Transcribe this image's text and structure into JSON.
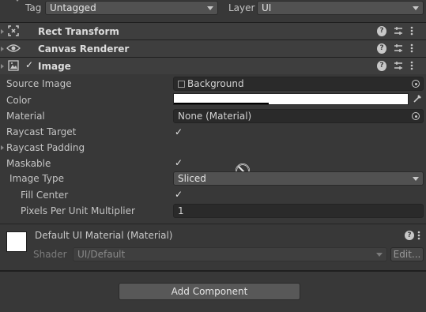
{
  "top": {
    "tag_label": "Tag",
    "tag_value": "Untagged",
    "layer_label": "Layer",
    "layer_value": "UI"
  },
  "components": {
    "rect_transform": "Rect Transform",
    "canvas_renderer": "Canvas Renderer",
    "image": "Image"
  },
  "image_props": {
    "source_image_label": "Source Image",
    "source_image_value": "Background",
    "color_label": "Color",
    "color_value": "#ffffff",
    "material_label": "Material",
    "material_value": "None (Material)",
    "raycast_target_label": "Raycast Target",
    "raycast_target_checked": true,
    "raycast_padding_label": "Raycast Padding",
    "maskable_label": "Maskable",
    "maskable_checked": true,
    "image_type_label": "Image Type",
    "image_type_value": "Sliced",
    "fill_center_label": "Fill Center",
    "fill_center_checked": true,
    "ppu_label": "Pixels Per Unit Multiplier",
    "ppu_value": "1"
  },
  "material_section": {
    "title": "Default UI Material (Material)",
    "shader_label": "Shader",
    "shader_value": "UI/Default",
    "edit_button": "Edit..."
  },
  "add_component_label": "Add Component",
  "check_glyph": "✓"
}
